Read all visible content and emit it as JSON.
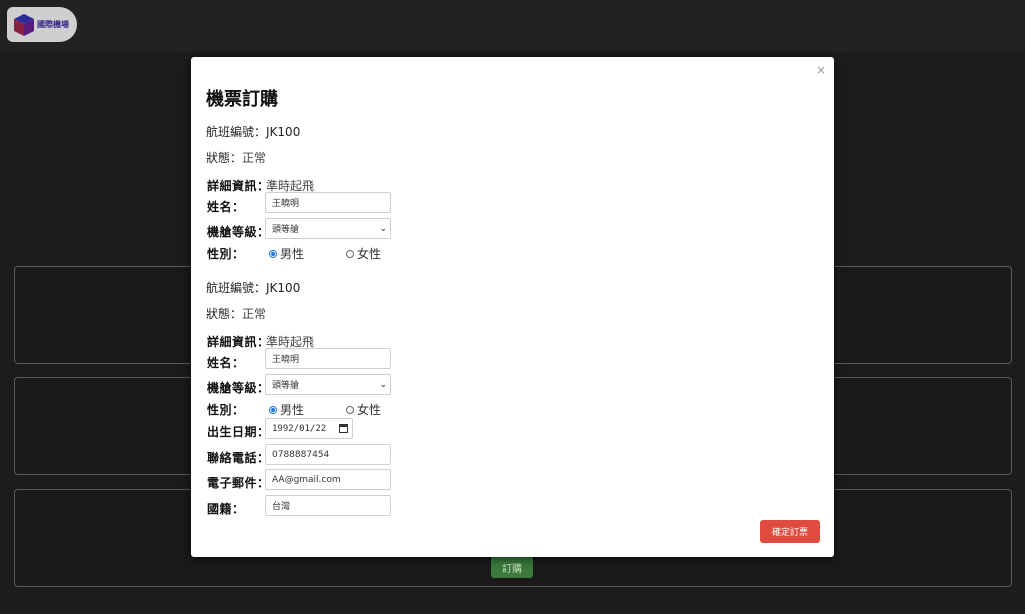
{
  "header": {
    "logo_text": "國際機場",
    "logo_icon": "cube-icon"
  },
  "background": {
    "order_button_label": "訂購"
  },
  "modal": {
    "close_label": "×",
    "title": "機票訂購",
    "confirm_label": "確定訂票",
    "sections": [
      {
        "flight_label": "航班編號：",
        "flight_value": "JK100",
        "status_label": "狀態：",
        "status_value": "正常",
        "detail_label": "詳細資訊：",
        "detail_value": "準時起飛",
        "name_label": "姓名：",
        "name_value": "王曉明",
        "cabin_label": "機艙等級：",
        "cabin_value": "頭等艙",
        "gender_label": "性別：",
        "gender_male": "男性",
        "gender_female": "女性",
        "gender_selected": "男性"
      },
      {
        "flight_label": "航班編號：",
        "flight_value": "JK100",
        "status_label": "狀態：",
        "status_value": "正常",
        "detail_label": "詳細資訊：",
        "detail_value": "準時起飛",
        "name_label": "姓名：",
        "name_value": "王曉明",
        "cabin_label": "機艙等級：",
        "cabin_value": "頭等艙",
        "gender_label": "性別：",
        "gender_male": "男性",
        "gender_female": "女性",
        "gender_selected": "男性",
        "birth_label": "出生日期：",
        "birth_value": "1992/01/22",
        "phone_label": "聯絡電話：",
        "phone_value": "0788887454",
        "email_label": "電子郵件：",
        "email_value": "AA@gmail.com",
        "nationality_label": "國籍：",
        "nationality_value": "台灣"
      }
    ]
  }
}
